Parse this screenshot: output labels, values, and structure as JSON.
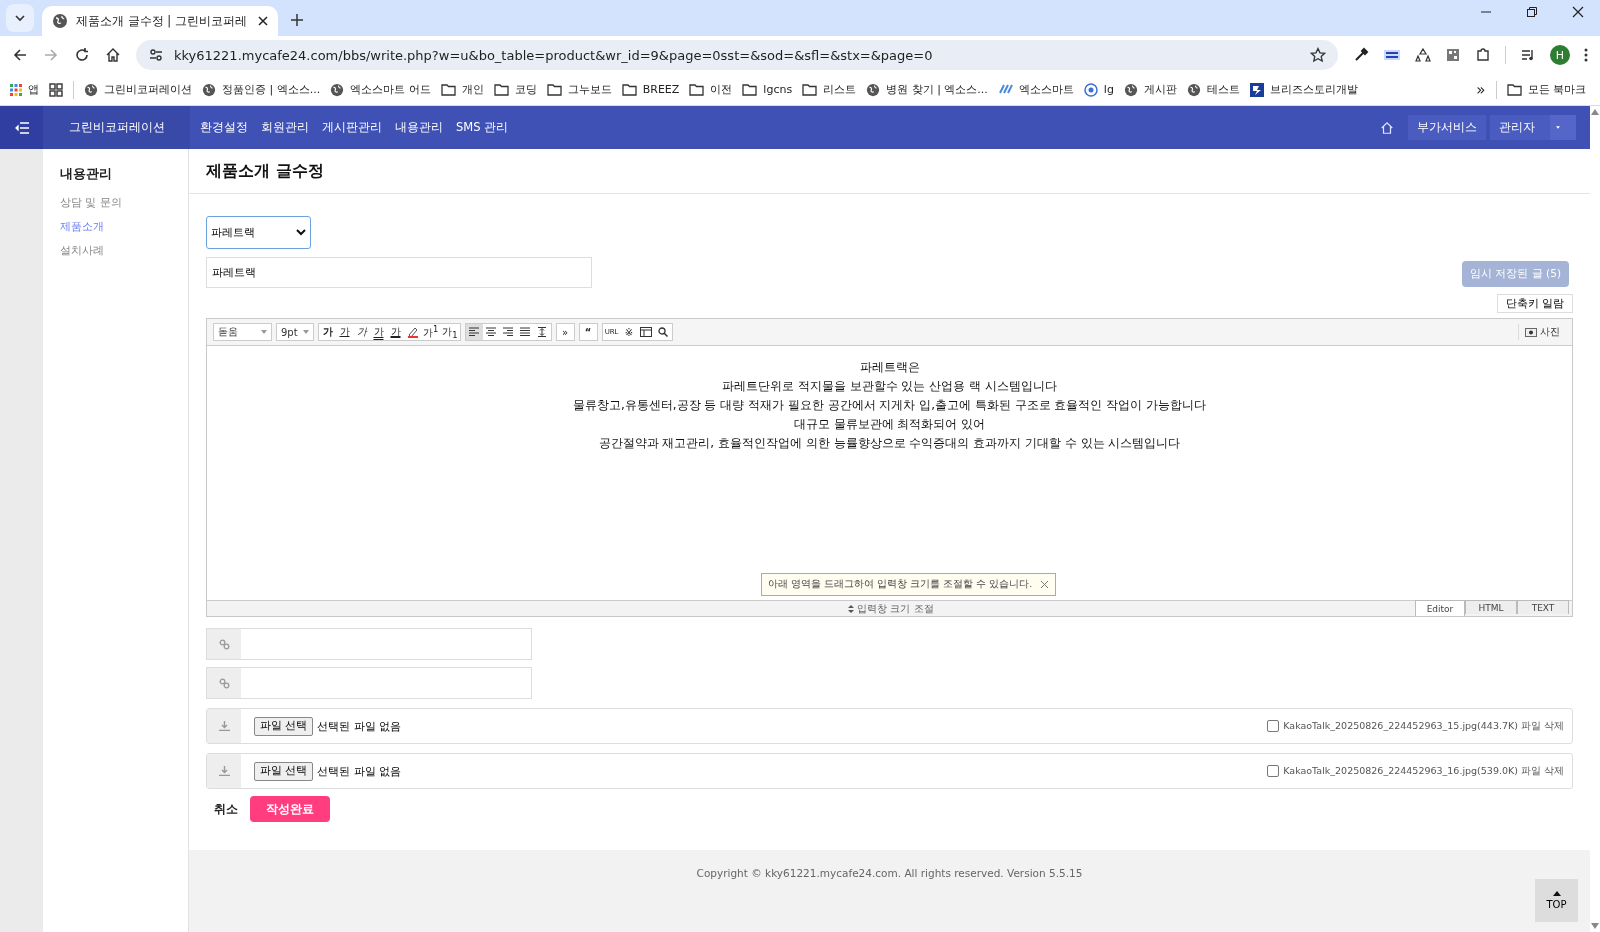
{
  "browser": {
    "tabs": [
      {
        "title": "제품소개 글수정 | 그린비코퍼레",
        "selected": true
      }
    ],
    "url": "kky61221.mycafe24.com/bbs/write.php?w=u&bo_table=product&wr_id=9&page=0sst=&sod=&sfl=&stx=&page=0",
    "profile": "H",
    "bookmarks": [
      {
        "kind": "apps",
        "label": "앱"
      },
      {
        "kind": "grid"
      },
      {
        "kind": "globe",
        "label": "그린비코퍼레이션"
      },
      {
        "kind": "globe",
        "label": "정품인증 | 엑소스..."
      },
      {
        "kind": "globe",
        "label": "엑소스마트 어드"
      },
      {
        "kind": "folder",
        "label": "개인"
      },
      {
        "kind": "folder",
        "label": "코딩"
      },
      {
        "kind": "folder",
        "label": "그누보드"
      },
      {
        "kind": "folder",
        "label": "BREEZ"
      },
      {
        "kind": "folder",
        "label": "이전"
      },
      {
        "kind": "folder",
        "label": "lgcns"
      },
      {
        "kind": "folder",
        "label": "리스트"
      },
      {
        "kind": "globe",
        "label": "병원 찾기 | 엑소스..."
      },
      {
        "kind": "wave",
        "label": "엑소스마트"
      },
      {
        "kind": "target",
        "label": "lg"
      },
      {
        "kind": "globe",
        "label": "게시판"
      },
      {
        "kind": "globe",
        "label": "테스트"
      },
      {
        "kind": "brand",
        "label": "브리즈스토리개발"
      }
    ],
    "more": "»",
    "all_bookmarks": "모든 북마크"
  },
  "header": {
    "brand": "그린비코퍼레이션",
    "menu": [
      "환경설정",
      "회원관리",
      "게시판관리",
      "내용관리",
      "SMS 관리"
    ],
    "services": "부가서비스",
    "admin": "관리자"
  },
  "sidebar": {
    "title": "내용관리",
    "items": [
      {
        "label": "상담 및 문의",
        "selected": false
      },
      {
        "label": "제품소개",
        "selected": true
      },
      {
        "label": "설치사례",
        "selected": false
      }
    ]
  },
  "page_title": "제품소개 글수정",
  "form": {
    "category": "파레트랙",
    "subject": "파레트랙",
    "temp_saved": "임시 저장된 글 (5)",
    "shortcuts": "단축키 일람",
    "editor": {
      "font": "돋움",
      "size": "9pt",
      "toolbar": [
        [
          {
            "kind": "text",
            "label": "가"
          },
          {
            "kind": "text",
            "label": "가"
          },
          {
            "kind": "text",
            "label": "가"
          },
          {
            "kind": "text",
            "label": "가"
          },
          {
            "kind": "text",
            "label": "가"
          },
          {
            "kind": "icon"
          },
          {
            "kind": "text",
            "label": "가$^{1}$"
          },
          {
            "kind": "text",
            "label": "가$_{1}$"
          }
        ],
        [
          {
            "kind": "icon"
          },
          {
            "kind": "icon"
          },
          {
            "kind": "icon"
          },
          {
            "kind": "icon"
          },
          {
            "kind": "icon"
          }
        ],
        [
          {
            "kind": "text",
            "label": "»"
          }
        ],
        [
          {
            "kind": "text",
            "label": "“"
          }
        ],
        [
          {
            "kind": "text",
            "label": "URL"
          },
          {
            "kind": "text",
            "label": "※"
          },
          {
            "kind": "icon"
          },
          {
            "kind": "icon"
          }
        ]
      ],
      "photo": "사진",
      "lines": [
        "파레트랙은",
        "파레트단위로 적지물을 보관할수 있는 산업용 랙 시스템입니다",
        "물류창고,유통센터,공장 등 대량 적재가 필요한 공간에서 지게차 입,출고에 특화된 구조로 효율적인 작업이 가능합니다",
        "대규모 물류보관에 최적화되어 있어",
        "공간절약과 재고관리, 효율적인작업에 의한 능률향상으로 수익증대의 효과까지 기대할 수 있는 시스템입니다"
      ],
      "tooltip": "아래 영역을 드래그하여 입력창 크기를 조절할 수 있습니다.",
      "resize": "입력창 크기 조절",
      "modes": [
        {
          "label": "Editor",
          "selected": true
        },
        {
          "label": "HTML",
          "selected": false
        },
        {
          "label": "TEXT",
          "selected": false
        }
      ]
    },
    "links": [
      {
        "kind": "url"
      },
      {
        "kind": "url"
      }
    ],
    "files": [
      {
        "button": "파일 선택",
        "status": "선택된 파일 없음",
        "existing": "KakaoTalk_20250826_224452963_15.jpg(443.7K) 파일 삭제",
        "checked": false
      },
      {
        "button": "파일 선택",
        "status": "선택된 파일 없음",
        "existing": "KakaoTalk_20250826_224452963_16.jpg(539.0K) 파일 삭제",
        "checked": false
      }
    ],
    "cancel": "취소",
    "submit": "작성완료"
  },
  "footer": {
    "copyright": "Copyright © kky61221.mycafe24.com. All rights reserved. Version 5.5.15",
    "top": "TOP"
  }
}
